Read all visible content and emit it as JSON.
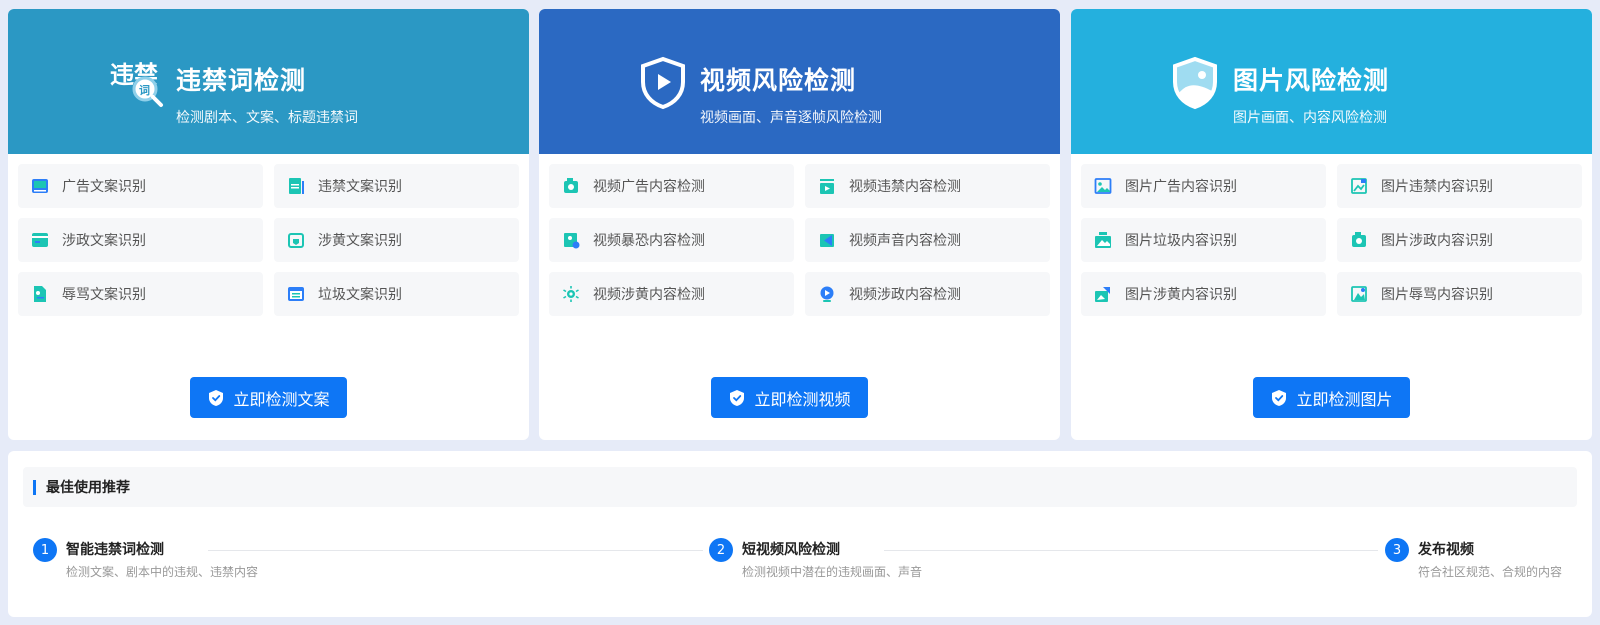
{
  "cards": [
    {
      "title": "违禁词检测",
      "desc": "检测剧本、文案、标题违禁词",
      "header_color": "#2b98c4",
      "icon": "forbidden-word-search-icon",
      "icon_text_main": "违禁",
      "icon_text_badge": "词",
      "items": [
        "广告文案识别",
        "违禁文案识别",
        "涉政文案识别",
        "涉黄文案识别",
        "辱骂文案识别",
        "垃圾文案识别"
      ],
      "button": "立即检测文案"
    },
    {
      "title": "视频风险检测",
      "desc": "视频画面、声音逐帧风险检测",
      "header_color": "#2b69c2",
      "icon": "video-shield-icon",
      "items": [
        "视频广告内容检测",
        "视频违禁内容检测",
        "视频暴恐内容检测",
        "视频声音内容检测",
        "视频涉黄内容检测",
        "视频涉政内容检测"
      ],
      "button": "立即检测视频"
    },
    {
      "title": "图片风险检测",
      "desc": "图片画面、内容风险检测",
      "header_color": "#24b0de",
      "icon": "image-shield-icon",
      "items": [
        "图片广告内容识别",
        "图片违禁内容识别",
        "图片垃圾内容识别",
        "图片涉政内容识别",
        "图片涉黄内容识别",
        "图片辱骂内容识别"
      ],
      "button": "立即检测图片"
    }
  ],
  "recommend": {
    "title": "最佳使用推荐",
    "steps": [
      {
        "num": "1",
        "title": "智能违禁词检测",
        "desc": "检测文案、剧本中的违规、违禁内容"
      },
      {
        "num": "2",
        "title": "短视频风险检测",
        "desc": "检测视频中潜在的违规画面、声音"
      },
      {
        "num": "3",
        "title": "发布视频",
        "desc": "符合社区规范、合规的内容"
      }
    ]
  },
  "colors": {
    "accent": "#0e76f5",
    "icon_teal": "#1cc5b4",
    "icon_blue": "#2c7ef8"
  }
}
